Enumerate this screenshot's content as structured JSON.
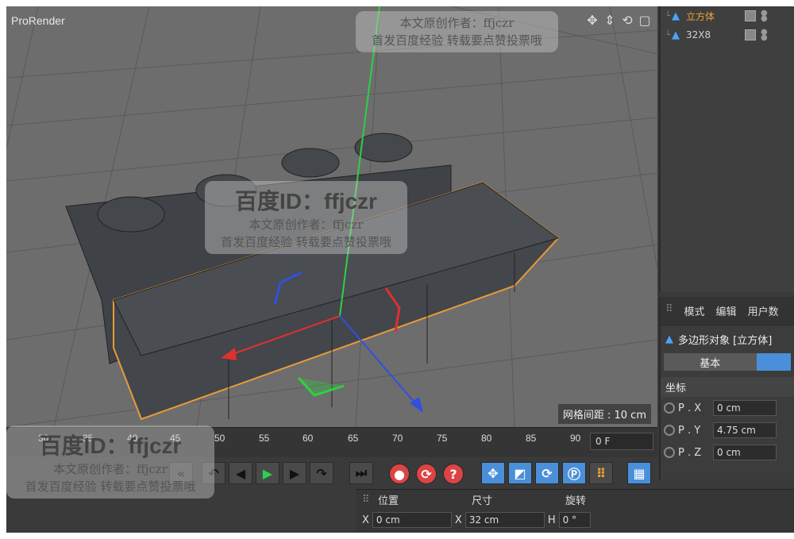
{
  "viewport": {
    "title": "ProRender",
    "grid_spacing": "网格间距 : 10 cm",
    "nav_icons": [
      "move-view-icon",
      "dolly-icon",
      "rotate-view-icon",
      "maximize-view-icon"
    ]
  },
  "watermarks": [
    {
      "line1": "本文原创作者：ffjczr",
      "line2": "首发百度经验 转载要点赞投票哦"
    },
    {
      "big": "百度ID：ffjczr",
      "line1": "本文原创作者：ffjczr",
      "line2": "首发百度经验 转载要点赞投票哦"
    },
    {
      "big": "百度ID：ffjczr",
      "line1": "本文原创作者：ffjczr",
      "line2": "首发百度经验 转载要点赞投票哦"
    }
  ],
  "objects": [
    {
      "name": "立方体",
      "color": "#f0a030"
    },
    {
      "name": "32X8",
      "color": "#cfcfcf"
    }
  ],
  "attributes": {
    "tabs": [
      "模式",
      "编辑",
      "用户数"
    ],
    "object_label": "多边形对象 [立方体]",
    "basic_tab": "基本",
    "coord_header": "坐标",
    "coords": [
      {
        "label": "P . X",
        "value": "0 cm"
      },
      {
        "label": "P . Y",
        "value": "4.75 cm"
      },
      {
        "label": "P . Z",
        "value": "0 cm"
      }
    ]
  },
  "timeline": {
    "ticks": [
      "30",
      "35",
      "40",
      "45",
      "50",
      "55",
      "60",
      "65",
      "70",
      "75",
      "80",
      "85",
      "90"
    ],
    "current_frame": "0 F"
  },
  "coord_manager": {
    "headers": {
      "position": "位置",
      "size": "尺寸",
      "rotation": "旋转"
    },
    "x_label": "X",
    "x_value": "0 cm",
    "size_x_label": "X",
    "size_x_value": "32 cm",
    "h_label": "H",
    "h_value": "0 °"
  },
  "colors": {
    "accent_selected": "#f0a030",
    "selection_outline": "#e89a3a",
    "axis_x": "#e03030",
    "axis_y": "#30d040",
    "axis_z": "#3050e0"
  }
}
